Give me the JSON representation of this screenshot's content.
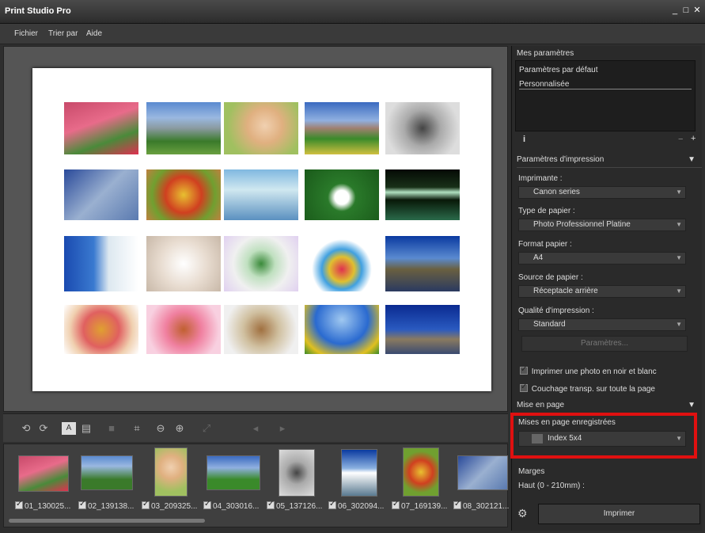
{
  "window": {
    "title": "Print Studio Pro",
    "controls": [
      "_",
      "□",
      "✕"
    ]
  },
  "menu": [
    "Fichier",
    "Trier par",
    "Aide"
  ],
  "filmstrip": {
    "items": [
      "01_130025...",
      "02_139138...",
      "03_209325...",
      "04_303016...",
      "05_137126...",
      "06_302094...",
      "07_169139...",
      "08_302121..."
    ]
  },
  "panel": {
    "my_settings": {
      "header": "Mes paramètres",
      "items": [
        "Paramètres par défaut",
        "Personnalisée"
      ],
      "info_icon": "i",
      "minus": "−",
      "plus": "+"
    },
    "print_settings": {
      "header": "Paramètres d'impression",
      "printer_label": "Imprimante :",
      "printer_value": "Canon               series",
      "paper_type_label": "Type de papier :",
      "paper_type_value": "Photo Professionnel Platine",
      "paper_size_label": "Format papier :",
      "paper_size_value": "A4",
      "paper_source_label": "Source de papier :",
      "paper_source_value": "Réceptacle arrière",
      "quality_label": "Qualité d'impression :",
      "quality_value": "Standard",
      "params_button": "Paramètres...",
      "bw_checkbox": "Imprimer une photo en noir et blanc",
      "coating_checkbox": "Couchage transp. sur toute la page"
    },
    "layout": {
      "header": "Mise en page",
      "saved_label": "Mises en page enregistrées",
      "saved_value": "Index 5x4",
      "margins_label": "Marges",
      "top_label": "Haut (0 - 210mm) :"
    },
    "print_button": "Imprimer"
  },
  "colors": {
    "highlight_border": "#e01010",
    "panel_bg": "#2a2a2a",
    "preview_bg": "#555555"
  }
}
